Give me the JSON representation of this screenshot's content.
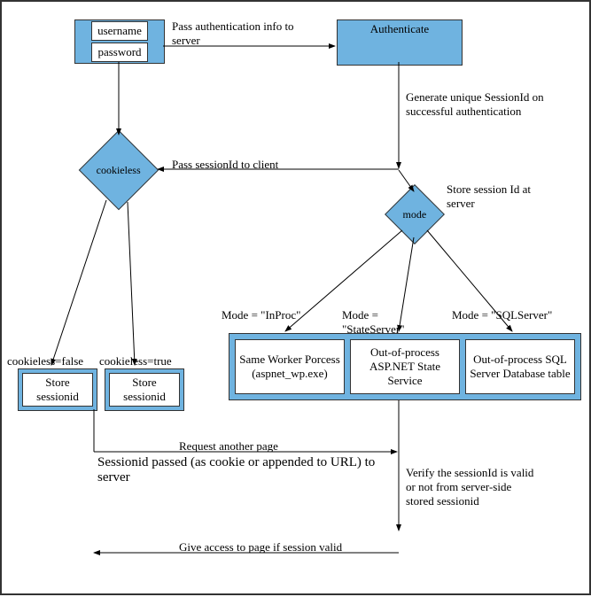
{
  "login": {
    "username": "username",
    "password": "password"
  },
  "auth": {
    "title": "Authenticate"
  },
  "cookieless": {
    "label": "cookieless"
  },
  "mode": {
    "label": "mode"
  },
  "edges": {
    "passAuth": "Pass authentication info to server",
    "generate": "Generate unique SessionId on successful authentication",
    "passSession": "Pass sessionId to client",
    "storeServer": "Store session Id at server",
    "cfalse": "cookieless=false",
    "ctrue": "cookieless=true",
    "mInproc": "Mode = \"InProc\"",
    "mState": "Mode = \"StateServer\"",
    "mSql": "Mode = \"SQLServer\"",
    "request": "Request another page",
    "passed": "Sessionid passed (as cookie or appended to URL) to server",
    "verify": "Verify the sessionId is valid or not from server-side stored sessionid",
    "give": "Give access to page if session valid"
  },
  "store": {
    "a": "Store sessionid",
    "b": "Store sessionid"
  },
  "modes": {
    "inproc": "Same Worker Porcess (aspnet_wp.exe)",
    "state": "Out-of-process ASP.NET State Service",
    "sql": "Out-of-process SQL Server Database table"
  }
}
